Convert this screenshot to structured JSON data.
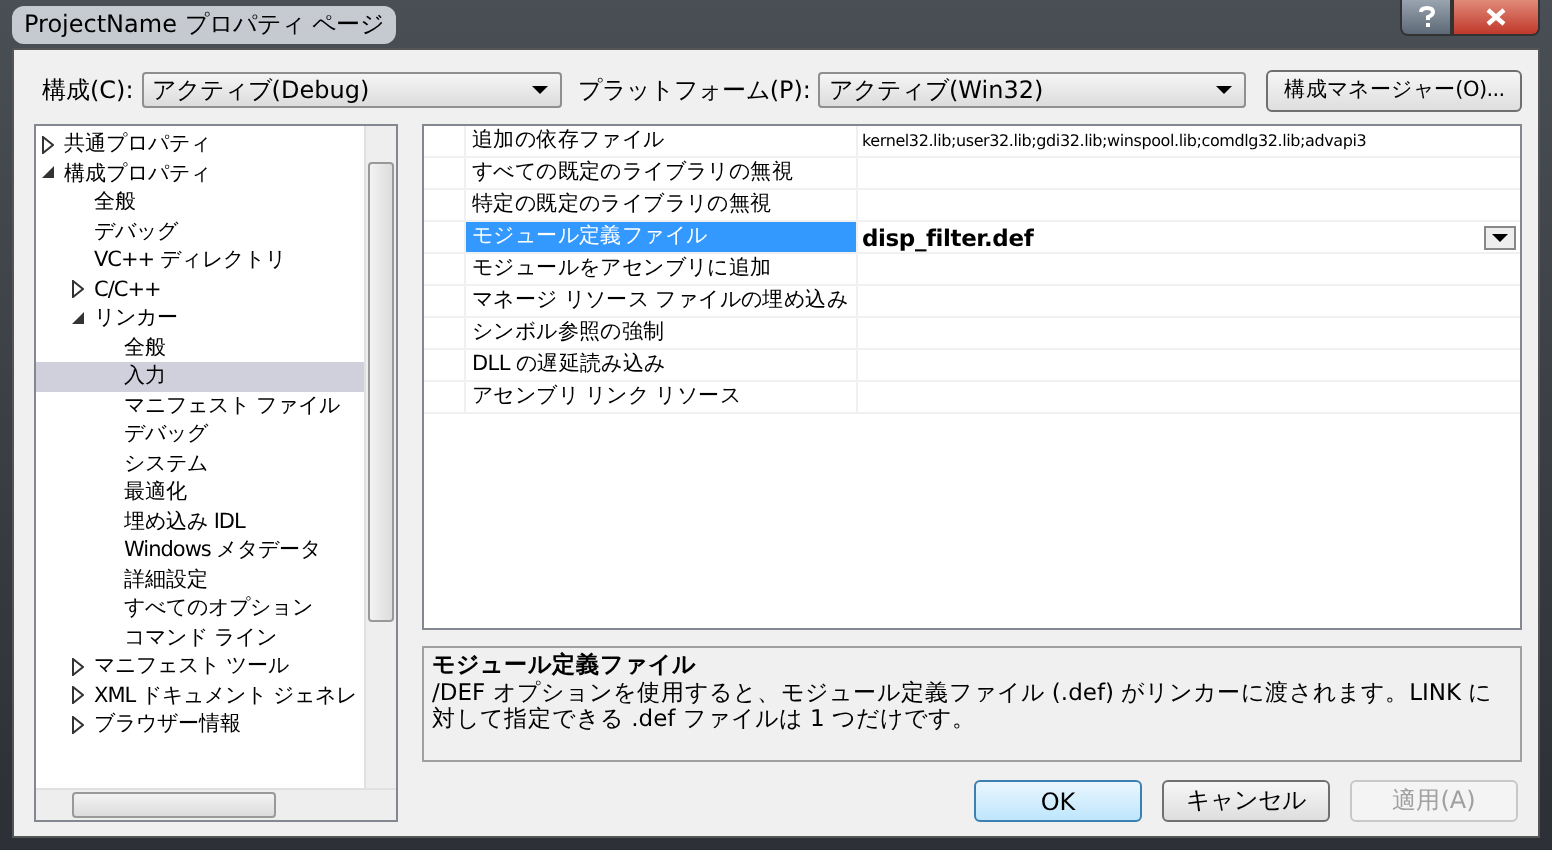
{
  "window": {
    "title": "ProjectName プロパティ ページ"
  },
  "config": {
    "label": "構成(C):",
    "value": "アクティブ(Debug)"
  },
  "platform": {
    "label": "プラットフォーム(P):",
    "value": "アクティブ(Win32)"
  },
  "config_manager_button": "構成マネージャー(O)...",
  "tree": [
    {
      "label": "共通プロパティ",
      "expanded": false,
      "selected": false
    },
    {
      "label": "構成プロパティ",
      "expanded": true,
      "selected": false,
      "children": [
        {
          "label": "全般",
          "selected": false
        },
        {
          "label": "デバッグ",
          "selected": false
        },
        {
          "label": "VC++ ディレクトリ",
          "selected": false
        },
        {
          "label": "C/C++",
          "expanded": false,
          "selected": false
        },
        {
          "label": "リンカー",
          "expanded": true,
          "selected": false,
          "children": [
            {
              "label": "全般",
              "selected": false
            },
            {
              "label": "入力",
              "selected": true
            },
            {
              "label": "マニフェスト ファイル",
              "selected": false
            },
            {
              "label": "デバッグ",
              "selected": false
            },
            {
              "label": "システム",
              "selected": false
            },
            {
              "label": "最適化",
              "selected": false
            },
            {
              "label": "埋め込み IDL",
              "selected": false
            },
            {
              "label": "Windows メタデータ",
              "selected": false
            },
            {
              "label": "詳細設定",
              "selected": false
            },
            {
              "label": "すべてのオプション",
              "selected": false
            },
            {
              "label": "コマンド ライン",
              "selected": false
            }
          ]
        },
        {
          "label": "マニフェスト ツール",
          "expanded": false,
          "selected": false
        },
        {
          "label": "XML ドキュメント ジェネレ",
          "expanded": false,
          "selected": false
        },
        {
          "label": "ブラウザー情報",
          "expanded": false,
          "selected": false
        }
      ]
    }
  ],
  "properties": [
    {
      "name": "追加の依存ファイル",
      "value": "kernel32.lib;user32.lib;gdi32.lib;winspool.lib;comdlg32.lib;advapi3",
      "selected": false
    },
    {
      "name": "すべての既定のライブラリの無視",
      "selected": false
    },
    {
      "name": "特定の既定のライブラリの無視",
      "selected": false
    },
    {
      "name": "モジュール定義ファイル",
      "value": "disp_filter.def",
      "selected": true
    },
    {
      "name": "モジュールをアセンブリに追加",
      "selected": false
    },
    {
      "name": "マネージ リソース ファイルの埋め込み",
      "selected": false
    },
    {
      "name": "シンボル参照の強制",
      "selected": false
    },
    {
      "name": "DLL の遅延読み込み",
      "selected": false
    },
    {
      "name": "アセンブリ リンク リソース",
      "selected": false
    }
  ],
  "description": {
    "title": "モジュール定義ファイル",
    "text": "/DEF オプションを使用すると、モジュール定義ファイル (.def) がリンカーに渡されます。LINK に対して指定できる .def ファイルは 1 つだけです。"
  },
  "buttons": [
    {
      "label": "OK",
      "default": true,
      "disabled": false
    },
    {
      "label": "キャンセル",
      "default": false,
      "disabled": false
    },
    {
      "label": "適用(A)",
      "default": false,
      "disabled": true
    }
  ]
}
